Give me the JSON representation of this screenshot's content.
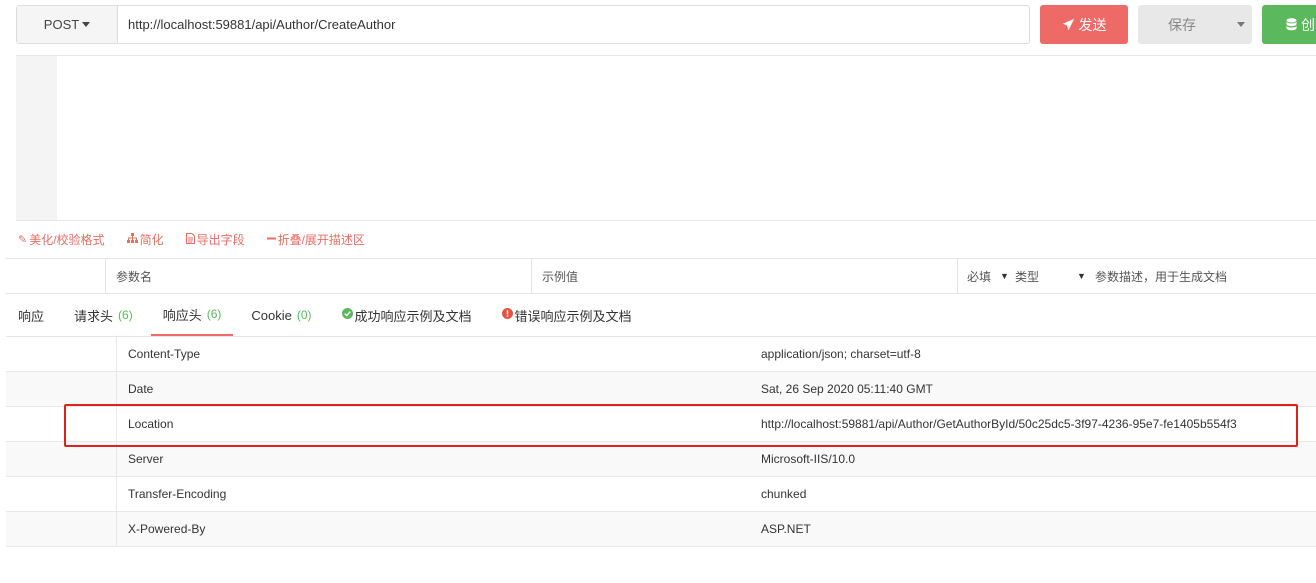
{
  "request": {
    "method": "POST",
    "url": "http://localhost:59881/api/Author/CreateAuthor"
  },
  "buttons": {
    "send": "发送",
    "save": "保存",
    "create": "创"
  },
  "editor_toolbar": {
    "beautify": "美化/校验格式",
    "simplify": "简化",
    "export_fields": "导出字段",
    "fold": "折叠/展开描述区"
  },
  "params_header": {
    "name": "参数名",
    "example": "示例值",
    "required": "必填",
    "type": "类型",
    "description": "参数描述，用于生成文档"
  },
  "tabs": [
    {
      "label": "响应",
      "count": ""
    },
    {
      "label": "请求头",
      "count": "(6)"
    },
    {
      "label": "响应头",
      "count": "(6)"
    },
    {
      "label": "Cookie",
      "count": "(0)"
    },
    {
      "label": "成功响应示例及文档",
      "count": ""
    },
    {
      "label": "错误响应示例及文档",
      "count": ""
    }
  ],
  "active_tab": "响应头",
  "response_headers": [
    {
      "key": "Content-Type",
      "value": "application/json; charset=utf-8"
    },
    {
      "key": "Date",
      "value": "Sat, 26 Sep 2020 05:11:40 GMT"
    },
    {
      "key": "Location",
      "value": "http://localhost:59881/api/Author/GetAuthorById/50c25dc5-3f97-4236-95e7-fe1405b554f3"
    },
    {
      "key": "Server",
      "value": "Microsoft-IIS/10.0"
    },
    {
      "key": "Transfer-Encoding",
      "value": "chunked"
    },
    {
      "key": "X-Powered-By",
      "value": "ASP.NET"
    }
  ],
  "colors": {
    "send": "#ee6a67",
    "create": "#5cb85c",
    "highlight": "#e0201c"
  }
}
